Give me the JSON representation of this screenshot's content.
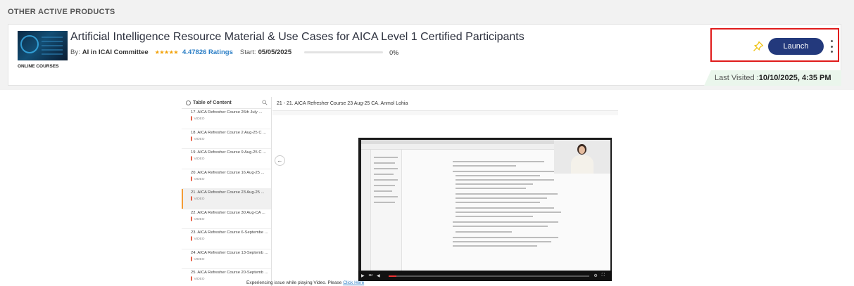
{
  "section": {
    "heading": "OTHER ACTIVE PRODUCTS"
  },
  "product": {
    "thumbnail_label": "ONLINE COURSES",
    "title": "Artificial Intelligence Resource Material & Use Cases for AICA Level 1 Certified Participants",
    "by_label": "By:",
    "by_name": "AI in ICAI Committee",
    "stars": "★★★★★",
    "rating_text": "4.47826 Ratings",
    "start_label": "Start:",
    "start_date": "05/05/2025",
    "progress_percent": 0,
    "progress_text": "0%",
    "launch_label": "Launch",
    "last_visited_label": "Last Visited :",
    "last_visited_value": "10/10/2025, 4:35 PM",
    "colors": {
      "launch": "#23397c",
      "highlight": "#e01b1b",
      "pin": "#f0c419",
      "rating": "#2c7fc6"
    }
  },
  "viewer": {
    "toc_title": "Table of Content",
    "content_title": "21 - 21. AICA Refresher Course 23 Aug-25 CA. Anmol Lohia",
    "items": [
      {
        "title": "17. AICA Refresher Course 26th July ...",
        "type": "VIDEO"
      },
      {
        "title": "18. AICA Refresher Course 2 Aug-25 C ...",
        "type": "VIDEO"
      },
      {
        "title": "19. AICA Refresher Course 9 Aug-25 C ...",
        "type": "VIDEO"
      },
      {
        "title": "20. AICA Refresher Course 16 Aug-25 ...",
        "type": "VIDEO"
      },
      {
        "title": "21. AICA Refresher Course 23 Aug-25 ...",
        "type": "VIDEO",
        "active": true
      },
      {
        "title": "22. AICA Refresher Course 30 Aug-CA ...",
        "type": "VIDEO"
      },
      {
        "title": "23. AICA Refresher Course 6-Septembe ...",
        "type": "VIDEO"
      },
      {
        "title": "24. AICA Refresher Course 13-Septemb ...",
        "type": "VIDEO"
      },
      {
        "title": "25. AICA Refresher Course 20-Septemb ...",
        "type": "VIDEO"
      }
    ],
    "issue_text": "Experiencing issue while playing Video. Please",
    "issue_link": "Click Here"
  }
}
